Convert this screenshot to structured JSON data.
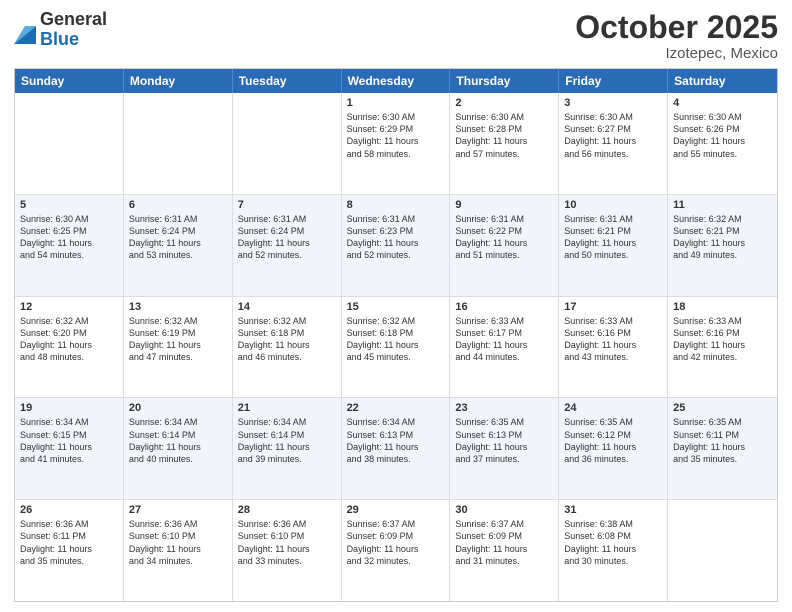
{
  "logo": {
    "general": "General",
    "blue": "Blue"
  },
  "title": "October 2025",
  "location": "Izotepec, Mexico",
  "days": [
    "Sunday",
    "Monday",
    "Tuesday",
    "Wednesday",
    "Thursday",
    "Friday",
    "Saturday"
  ],
  "rows": [
    [
      {
        "day": "",
        "text": ""
      },
      {
        "day": "",
        "text": ""
      },
      {
        "day": "",
        "text": ""
      },
      {
        "day": "1",
        "text": "Sunrise: 6:30 AM\nSunset: 6:29 PM\nDaylight: 11 hours\nand 58 minutes."
      },
      {
        "day": "2",
        "text": "Sunrise: 6:30 AM\nSunset: 6:28 PM\nDaylight: 11 hours\nand 57 minutes."
      },
      {
        "day": "3",
        "text": "Sunrise: 6:30 AM\nSunset: 6:27 PM\nDaylight: 11 hours\nand 56 minutes."
      },
      {
        "day": "4",
        "text": "Sunrise: 6:30 AM\nSunset: 6:26 PM\nDaylight: 11 hours\nand 55 minutes."
      }
    ],
    [
      {
        "day": "5",
        "text": "Sunrise: 6:30 AM\nSunset: 6:25 PM\nDaylight: 11 hours\nand 54 minutes."
      },
      {
        "day": "6",
        "text": "Sunrise: 6:31 AM\nSunset: 6:24 PM\nDaylight: 11 hours\nand 53 minutes."
      },
      {
        "day": "7",
        "text": "Sunrise: 6:31 AM\nSunset: 6:24 PM\nDaylight: 11 hours\nand 52 minutes."
      },
      {
        "day": "8",
        "text": "Sunrise: 6:31 AM\nSunset: 6:23 PM\nDaylight: 11 hours\nand 52 minutes."
      },
      {
        "day": "9",
        "text": "Sunrise: 6:31 AM\nSunset: 6:22 PM\nDaylight: 11 hours\nand 51 minutes."
      },
      {
        "day": "10",
        "text": "Sunrise: 6:31 AM\nSunset: 6:21 PM\nDaylight: 11 hours\nand 50 minutes."
      },
      {
        "day": "11",
        "text": "Sunrise: 6:32 AM\nSunset: 6:21 PM\nDaylight: 11 hours\nand 49 minutes."
      }
    ],
    [
      {
        "day": "12",
        "text": "Sunrise: 6:32 AM\nSunset: 6:20 PM\nDaylight: 11 hours\nand 48 minutes."
      },
      {
        "day": "13",
        "text": "Sunrise: 6:32 AM\nSunset: 6:19 PM\nDaylight: 11 hours\nand 47 minutes."
      },
      {
        "day": "14",
        "text": "Sunrise: 6:32 AM\nSunset: 6:18 PM\nDaylight: 11 hours\nand 46 minutes."
      },
      {
        "day": "15",
        "text": "Sunrise: 6:32 AM\nSunset: 6:18 PM\nDaylight: 11 hours\nand 45 minutes."
      },
      {
        "day": "16",
        "text": "Sunrise: 6:33 AM\nSunset: 6:17 PM\nDaylight: 11 hours\nand 44 minutes."
      },
      {
        "day": "17",
        "text": "Sunrise: 6:33 AM\nSunset: 6:16 PM\nDaylight: 11 hours\nand 43 minutes."
      },
      {
        "day": "18",
        "text": "Sunrise: 6:33 AM\nSunset: 6:16 PM\nDaylight: 11 hours\nand 42 minutes."
      }
    ],
    [
      {
        "day": "19",
        "text": "Sunrise: 6:34 AM\nSunset: 6:15 PM\nDaylight: 11 hours\nand 41 minutes."
      },
      {
        "day": "20",
        "text": "Sunrise: 6:34 AM\nSunset: 6:14 PM\nDaylight: 11 hours\nand 40 minutes."
      },
      {
        "day": "21",
        "text": "Sunrise: 6:34 AM\nSunset: 6:14 PM\nDaylight: 11 hours\nand 39 minutes."
      },
      {
        "day": "22",
        "text": "Sunrise: 6:34 AM\nSunset: 6:13 PM\nDaylight: 11 hours\nand 38 minutes."
      },
      {
        "day": "23",
        "text": "Sunrise: 6:35 AM\nSunset: 6:13 PM\nDaylight: 11 hours\nand 37 minutes."
      },
      {
        "day": "24",
        "text": "Sunrise: 6:35 AM\nSunset: 6:12 PM\nDaylight: 11 hours\nand 36 minutes."
      },
      {
        "day": "25",
        "text": "Sunrise: 6:35 AM\nSunset: 6:11 PM\nDaylight: 11 hours\nand 35 minutes."
      }
    ],
    [
      {
        "day": "26",
        "text": "Sunrise: 6:36 AM\nSunset: 6:11 PM\nDaylight: 11 hours\nand 35 minutes."
      },
      {
        "day": "27",
        "text": "Sunrise: 6:36 AM\nSunset: 6:10 PM\nDaylight: 11 hours\nand 34 minutes."
      },
      {
        "day": "28",
        "text": "Sunrise: 6:36 AM\nSunset: 6:10 PM\nDaylight: 11 hours\nand 33 minutes."
      },
      {
        "day": "29",
        "text": "Sunrise: 6:37 AM\nSunset: 6:09 PM\nDaylight: 11 hours\nand 32 minutes."
      },
      {
        "day": "30",
        "text": "Sunrise: 6:37 AM\nSunset: 6:09 PM\nDaylight: 11 hours\nand 31 minutes."
      },
      {
        "day": "31",
        "text": "Sunrise: 6:38 AM\nSunset: 6:08 PM\nDaylight: 11 hours\nand 30 minutes."
      },
      {
        "day": "",
        "text": ""
      }
    ]
  ]
}
